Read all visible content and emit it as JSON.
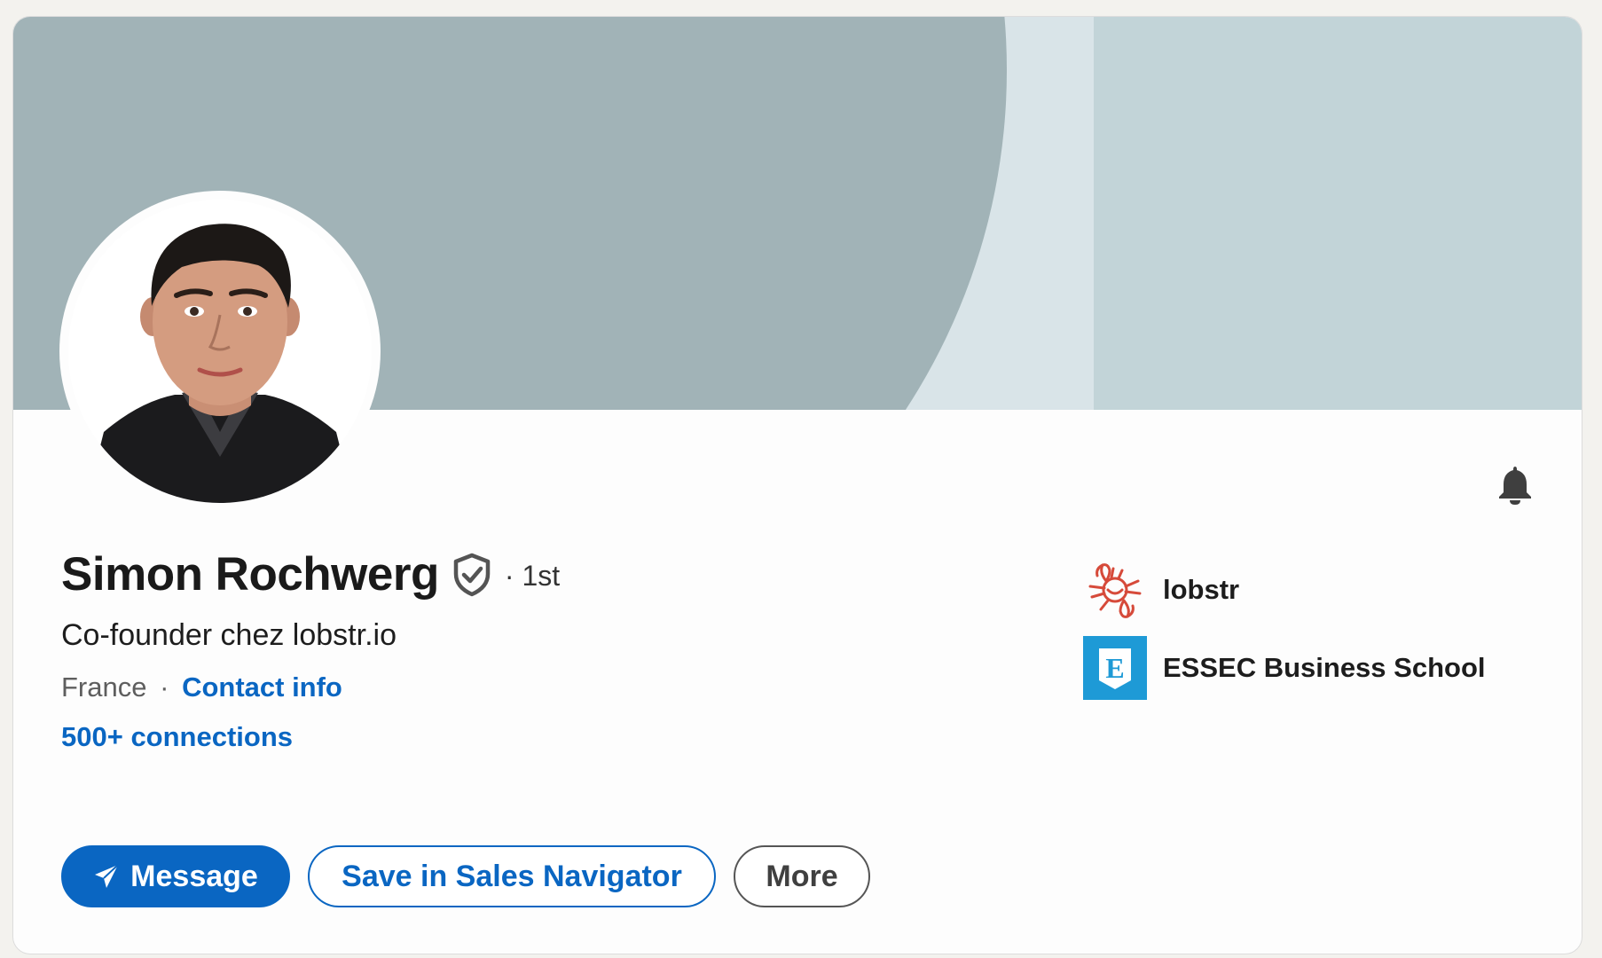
{
  "profile": {
    "name": "Simon Rochwerg",
    "degree": "· 1st",
    "headline": "Co-founder chez lobstr.io",
    "location": "France",
    "separator": "·",
    "contact_info": "Contact info",
    "connections": "500+ connections"
  },
  "affiliations": [
    {
      "name": "lobstr",
      "icon": "lobster-logo-icon",
      "color": "#d64a3a"
    },
    {
      "name": "ESSEC Business School",
      "icon": "essec-logo-icon",
      "logo_letter": "E",
      "color": "#1e9ad6"
    }
  ],
  "actions": {
    "message": "Message",
    "save_sales_navigator": "Save in Sales Navigator",
    "more": "More"
  },
  "colors": {
    "accent": "#0a66c2",
    "cover_disc": "#a1b3b7",
    "cover_band": "#d9e4e8",
    "cover_right": "#c2d4d8"
  }
}
